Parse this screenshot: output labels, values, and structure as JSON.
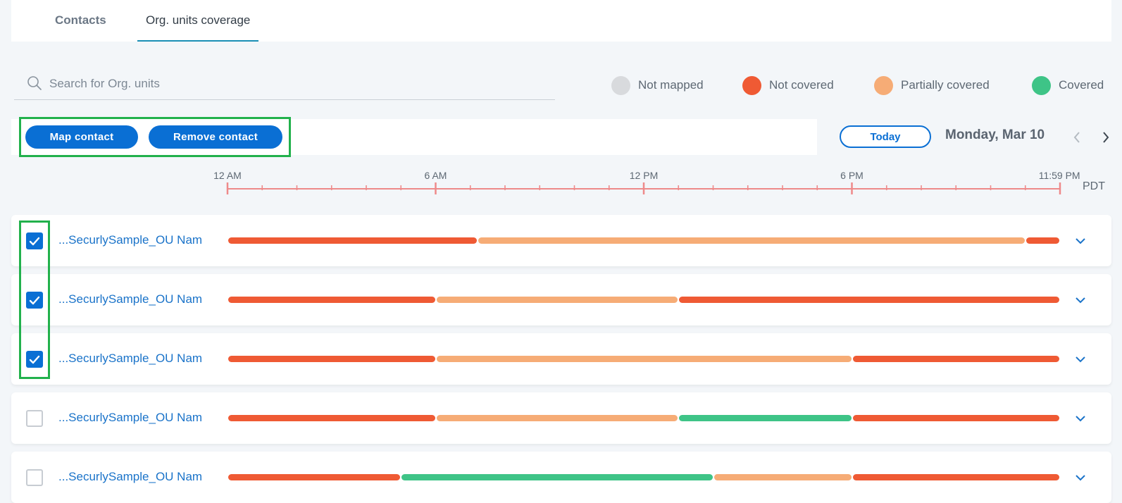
{
  "tabs": [
    {
      "label": "Contacts",
      "active": false
    },
    {
      "label": "Org. units coverage",
      "active": true
    }
  ],
  "search": {
    "placeholder": "Search for Org. units",
    "value": ""
  },
  "legend": [
    {
      "label": "Not mapped",
      "color": "#d8dadd"
    },
    {
      "label": "Not covered",
      "color": "#ef5a34"
    },
    {
      "label": "Partially covered",
      "color": "#f6ac76"
    },
    {
      "label": "Covered",
      "color": "#3ec487"
    }
  ],
  "toolbar": {
    "map_contact_label": "Map contact",
    "remove_contact_label": "Remove contact"
  },
  "date_nav": {
    "today_label": "Today",
    "date": "Monday, Mar 10"
  },
  "axis": {
    "labels": [
      {
        "text": "12 AM",
        "hour": 0
      },
      {
        "text": "6 AM",
        "hour": 6
      },
      {
        "text": "12 PM",
        "hour": 12
      },
      {
        "text": "6 PM",
        "hour": 18
      },
      {
        "text": "11:59 PM",
        "hour": 23.983
      }
    ],
    "timezone": "PDT"
  },
  "colors": {
    "accent": "#0a6fd4",
    "link": "#1a73c9",
    "highlight": "#22b14c",
    "axis": "#ee8a8a"
  },
  "rows": [
    {
      "name": "...SecurlySample_OU Nam",
      "checked": true,
      "segments": [
        {
          "status": "not_covered",
          "start": 0,
          "end": 7.2
        },
        {
          "status": "partial",
          "start": 7.2,
          "end": 23.0
        },
        {
          "status": "not_covered",
          "start": 23.0,
          "end": 24
        }
      ]
    },
    {
      "name": "...SecurlySample_OU Nam",
      "checked": true,
      "segments": [
        {
          "status": "not_covered",
          "start": 0,
          "end": 6
        },
        {
          "status": "partial",
          "start": 6,
          "end": 13
        },
        {
          "status": "not_covered",
          "start": 13,
          "end": 24
        }
      ]
    },
    {
      "name": "...SecurlySample_OU Nam",
      "checked": true,
      "segments": [
        {
          "status": "not_covered",
          "start": 0,
          "end": 6
        },
        {
          "status": "partial",
          "start": 6,
          "end": 18
        },
        {
          "status": "not_covered",
          "start": 18,
          "end": 24
        }
      ]
    },
    {
      "name": "...SecurlySample_OU Nam",
      "checked": false,
      "segments": [
        {
          "status": "not_covered",
          "start": 0,
          "end": 6
        },
        {
          "status": "partial",
          "start": 6,
          "end": 13
        },
        {
          "status": "covered",
          "start": 13,
          "end": 18
        },
        {
          "status": "not_covered",
          "start": 18,
          "end": 24
        }
      ]
    },
    {
      "name": "...SecurlySample_OU Nam",
      "checked": false,
      "segments": [
        {
          "status": "not_covered",
          "start": 0,
          "end": 5
        },
        {
          "status": "covered",
          "start": 5,
          "end": 14
        },
        {
          "status": "partial",
          "start": 14,
          "end": 18
        },
        {
          "status": "not_covered",
          "start": 18,
          "end": 24
        }
      ]
    }
  ]
}
